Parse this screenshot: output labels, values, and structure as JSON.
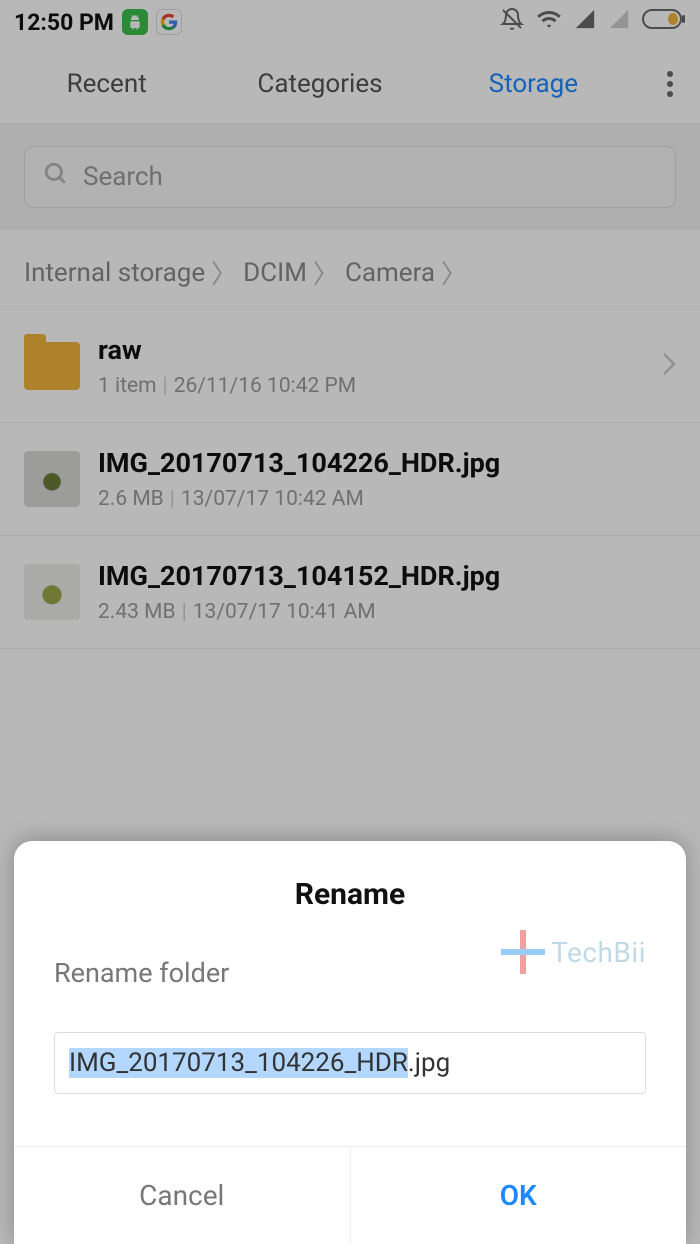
{
  "status": {
    "time": "12:50 PM",
    "left_icons": [
      "android-icon",
      "google-icon"
    ],
    "right_icons": [
      "bell-off-icon",
      "wifi-icon",
      "signal-strong-icon",
      "signal-weak-icon",
      "battery-icon"
    ]
  },
  "tabs": {
    "items": [
      {
        "label": "Recent",
        "active": false
      },
      {
        "label": "Categories",
        "active": false
      },
      {
        "label": "Storage",
        "active": true
      }
    ]
  },
  "search": {
    "placeholder": "Search"
  },
  "breadcrumb": {
    "parts": [
      "Internal storage",
      "DCIM",
      "Camera"
    ]
  },
  "files": [
    {
      "type": "folder",
      "name": "raw",
      "meta_left": "1 item",
      "meta_right": "26/11/16 10:42 PM"
    },
    {
      "type": "image",
      "name": "IMG_20170713_104226_HDR.jpg",
      "meta_left": "2.6 MB",
      "meta_right": "13/07/17 10:42 AM"
    },
    {
      "type": "image",
      "name": "IMG_20170713_104152_HDR.jpg",
      "meta_left": "2.43 MB",
      "meta_right": "13/07/17 10:41 AM"
    }
  ],
  "dialog": {
    "title": "Rename",
    "subtitle": "Rename folder",
    "input_selected": "IMG_20170713_104226_HDR",
    "input_rest": ".jpg",
    "cancel": "Cancel",
    "ok": "OK"
  },
  "watermark": {
    "text": "TechBii"
  }
}
